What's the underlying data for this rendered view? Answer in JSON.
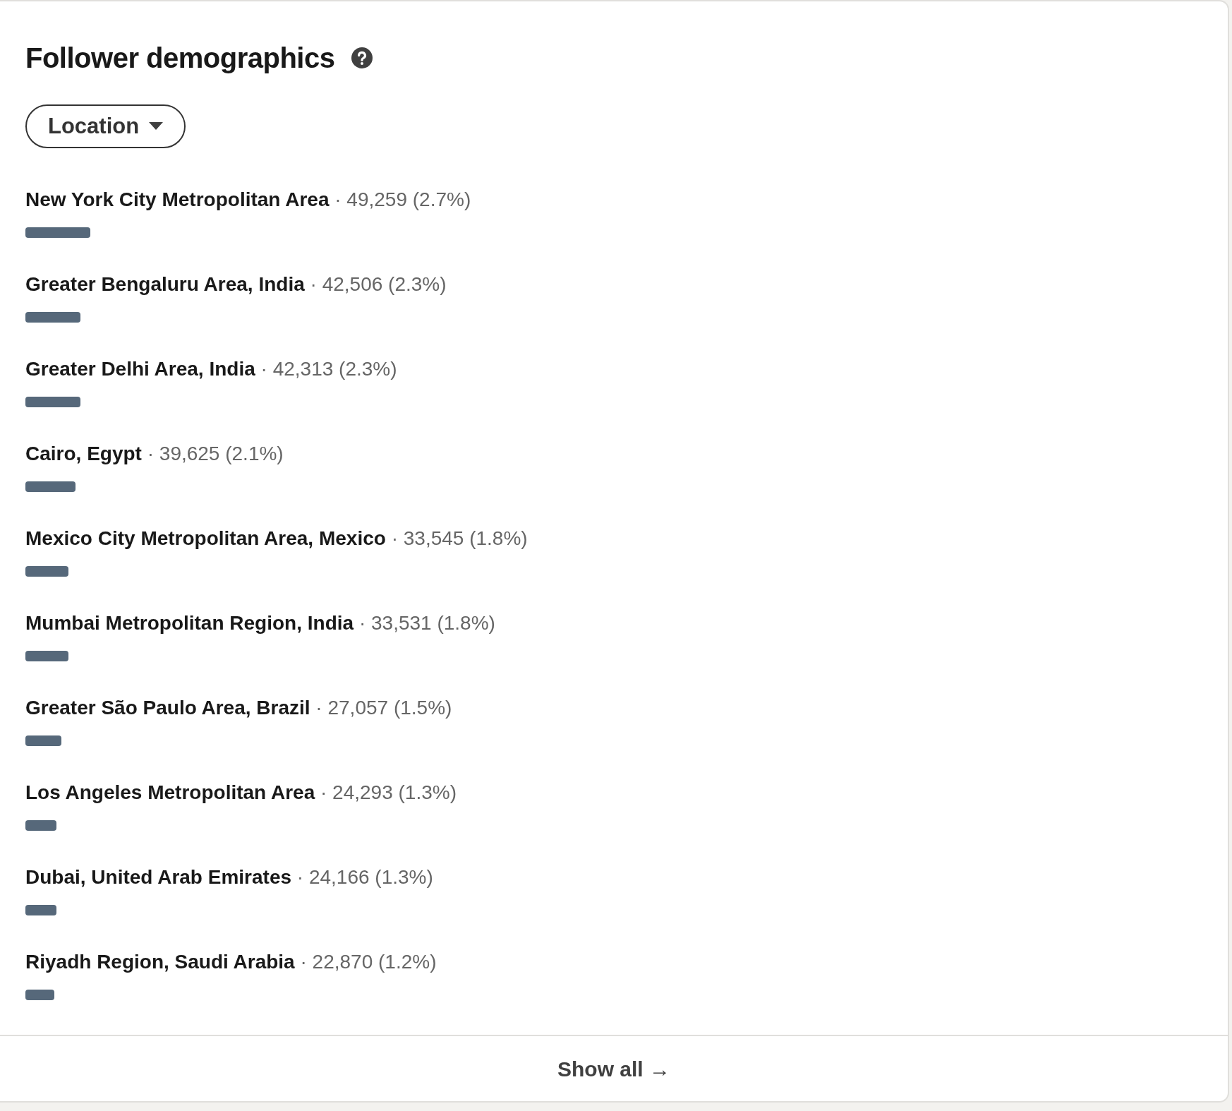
{
  "title": "Follower demographics",
  "filter": {
    "label": "Location"
  },
  "items": [
    {
      "name": "New York City Metropolitan Area",
      "separator": "·",
      "value": "49,259 (2.7%)"
    },
    {
      "name": "Greater Bengaluru Area, India",
      "separator": "·",
      "value": "42,506 (2.3%)"
    },
    {
      "name": "Greater Delhi Area, India",
      "separator": "·",
      "value": "42,313 (2.3%)"
    },
    {
      "name": "Cairo, Egypt",
      "separator": "·",
      "value": "39,625 (2.1%)"
    },
    {
      "name": "Mexico City Metropolitan Area, Mexico",
      "separator": "·",
      "value": "33,545 (1.8%)"
    },
    {
      "name": "Mumbai Metropolitan Region, India",
      "separator": "·",
      "value": "33,531 (1.8%)"
    },
    {
      "name": "Greater São Paulo Area, Brazil",
      "separator": "·",
      "value": "27,057 (1.5%)"
    },
    {
      "name": "Los Angeles Metropolitan Area",
      "separator": "·",
      "value": "24,293 (1.3%)"
    },
    {
      "name": "Dubai, United Arab Emirates",
      "separator": "·",
      "value": "24,166 (1.3%)"
    },
    {
      "name": "Riyadh Region, Saudi Arabia",
      "separator": "·",
      "value": "22,870 (1.2%)"
    }
  ],
  "footer": {
    "label": "Show all",
    "arrow": "→"
  }
}
